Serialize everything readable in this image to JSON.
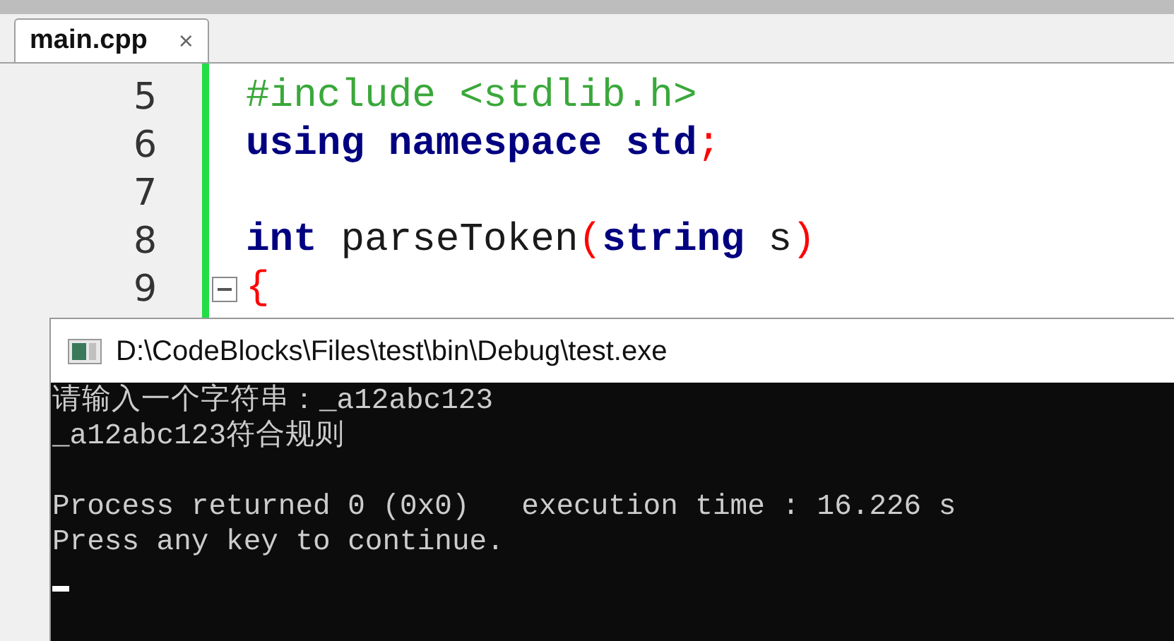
{
  "editor": {
    "tab": {
      "label": "main.cpp",
      "close": "×",
      "selected": true
    },
    "lines": [
      {
        "number": "5",
        "tokens": [
          {
            "text": "#include <stdlib.h>",
            "kind": "preprocessor"
          }
        ]
      },
      {
        "number": "6",
        "tokens": [
          {
            "text": "using",
            "kind": "keyword"
          },
          {
            "text": " namespace",
            "kind": "keyword"
          },
          {
            "text": " std",
            "kind": "keyword"
          },
          {
            "text": ";",
            "kind": "operator"
          }
        ]
      },
      {
        "number": "7"
      },
      {
        "number": "8",
        "tokens": [
          {
            "text": "int",
            "kind": "keyword"
          },
          {
            "text": " parseToken",
            "kind": "plain"
          },
          {
            "text": "(",
            "kind": "operator"
          },
          {
            "text": "string",
            "kind": "keyword"
          },
          {
            "text": " s",
            "kind": "plain"
          },
          {
            "text": ")",
            "kind": "operator"
          }
        ]
      },
      {
        "number": "9",
        "fold": true,
        "tokens": [
          {
            "text": "{",
            "kind": "operator"
          }
        ]
      }
    ]
  },
  "console": {
    "title": "D:\\CodeBlocks\\Files\\test\\bin\\Debug\\test.exe",
    "output": [
      "请输入一个字符串：_a12abc123",
      "_a12abc123符合规则"
    ],
    "status": [
      "Process returned 0 (0x0)   execution time : 16.226 s",
      "Press any key to continue."
    ],
    "cursor": true
  }
}
